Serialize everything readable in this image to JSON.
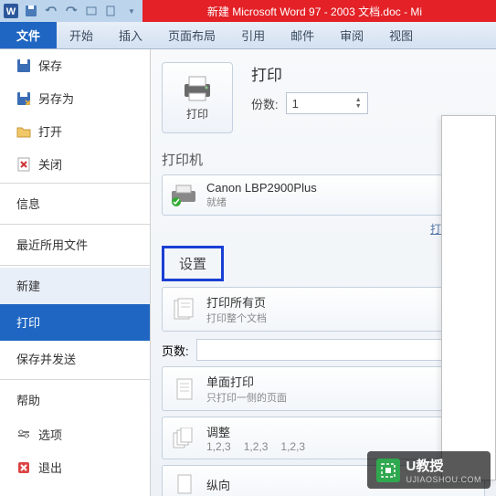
{
  "titlebar": {
    "title": "新建 Microsoft Word 97 - 2003 文档.doc - Mi"
  },
  "ribbon": {
    "tabs": [
      "文件",
      "开始",
      "插入",
      "页面布局",
      "引用",
      "邮件",
      "审阅",
      "视图"
    ]
  },
  "sidebar": {
    "save": "保存",
    "saveas": "另存为",
    "open": "打开",
    "close": "关闭",
    "info": "信息",
    "recent": "最近所用文件",
    "new": "新建",
    "print": "打印",
    "saveSend": "保存并发送",
    "help": "帮助",
    "options": "选项",
    "exit": "退出"
  },
  "print": {
    "title": "打印",
    "button": "打印",
    "copiesLabel": "份数:",
    "copiesValue": "1",
    "printerSection": "打印机",
    "printerName": "Canon LBP2900Plus",
    "printerStatus": "就绪",
    "printerProps": "打印机属性",
    "settingsSection": "设置",
    "allPages": "打印所有页",
    "allPagesSub": "打印整个文档",
    "pagesLabel": "页数:",
    "singleSide": "单面打印",
    "singleSideSub": "只打印一侧的页面",
    "collate": "调整",
    "collateSeq1": "1,2,3",
    "collateSeq2": "1,2,3",
    "collateSeq3": "1,2,3",
    "orientation": "纵向"
  },
  "watermark": {
    "brand": "U教授",
    "url": "UJIAOSHOU.COM"
  }
}
